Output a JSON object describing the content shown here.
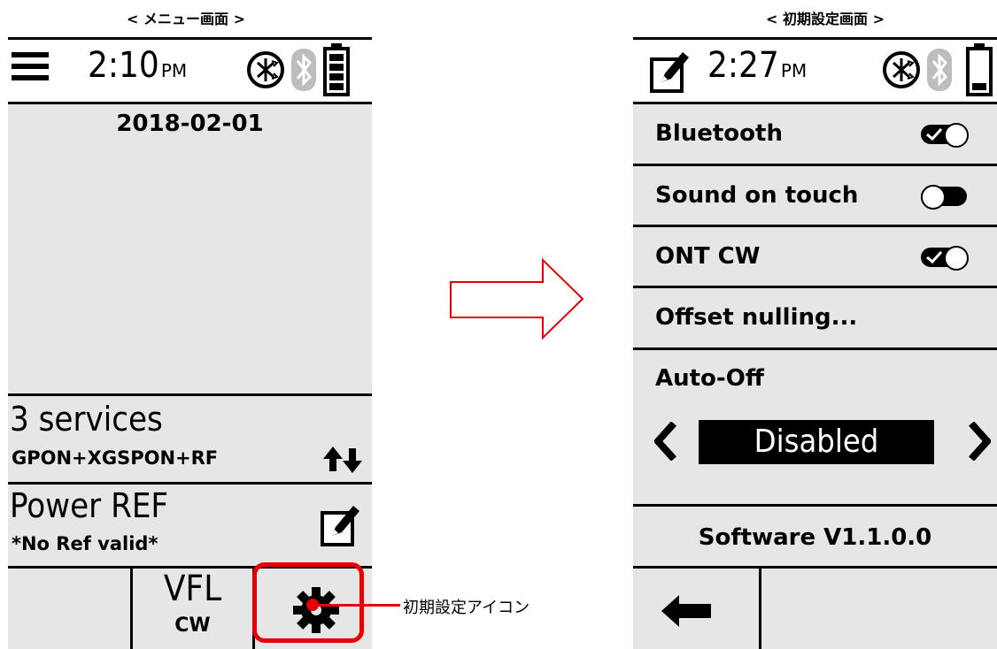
{
  "captions": {
    "menu_screen": "< メニュー画面 >",
    "settings_screen": "< 初期設定画面 >"
  },
  "menu": {
    "time": "2:10",
    "ampm": "PM",
    "date": "2018-02-01",
    "services_title": "3 services",
    "services_detail": "GPON+XGSPON+RF",
    "power_title": "Power REF",
    "power_detail": "*No Ref valid*",
    "vfl_label": "VFL",
    "vfl_mode": "CW"
  },
  "annotation": {
    "label": "初期設定アイコン",
    "highlight_color": "#e60000"
  },
  "settings": {
    "time": "2:27",
    "ampm": "PM",
    "rows": [
      {
        "label": "Bluetooth",
        "toggle": "on"
      },
      {
        "label": "Sound on touch",
        "toggle": "off"
      },
      {
        "label": "ONT CW",
        "toggle": "on"
      }
    ],
    "offset_nulling": "Offset nulling...",
    "auto_off_label": "Auto-Off",
    "auto_off_value": "Disabled",
    "software": "Software V1.1.0.0"
  },
  "icons": {
    "menu": "hamburger-icon",
    "fiber": "fiber-connector-icon",
    "bluetooth": "bluetooth-icon",
    "battery": "battery-icon",
    "edit": "edit-pencil-icon",
    "settings": "gear-icon",
    "sort": "up-down-arrows-icon",
    "back": "back-arrow-icon"
  }
}
